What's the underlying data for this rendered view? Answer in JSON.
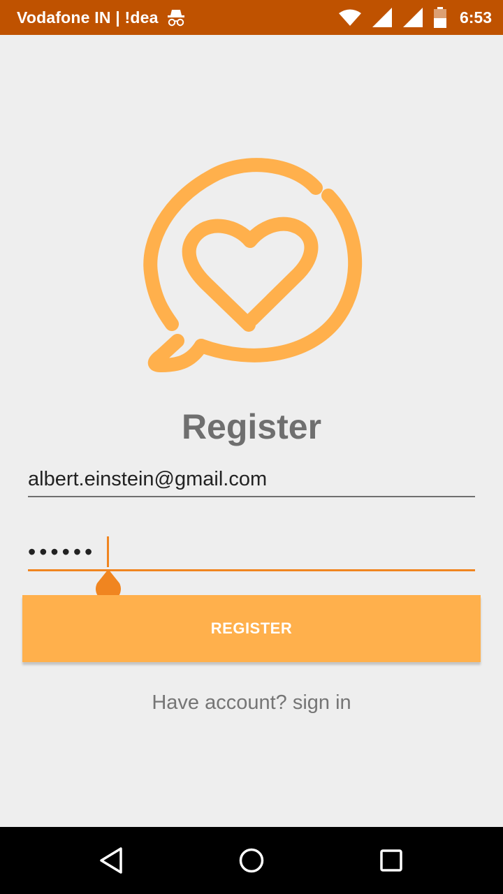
{
  "status_bar": {
    "carrier": "Vodafone IN | !dea",
    "time": "6:53",
    "icons": [
      "incognito-icon",
      "wifi-icon",
      "signal-icon",
      "signal-icon",
      "battery-icon"
    ]
  },
  "colors": {
    "status_bar": "#bf5200",
    "accent": "#ffb04c",
    "accent_dark": "#f08520",
    "background": "#eeeeee",
    "title_text": "#6f6f6f"
  },
  "logo": {
    "icon": "heart-chat-bubble-icon"
  },
  "form": {
    "title": "Register",
    "email_value": "albert.einstein@gmail.com",
    "password_masked": "••••••",
    "register_label": "REGISTER",
    "signin_text": "Have account? sign in"
  },
  "nav_bar": {
    "icons": [
      "back-icon",
      "home-icon",
      "recents-icon"
    ]
  }
}
